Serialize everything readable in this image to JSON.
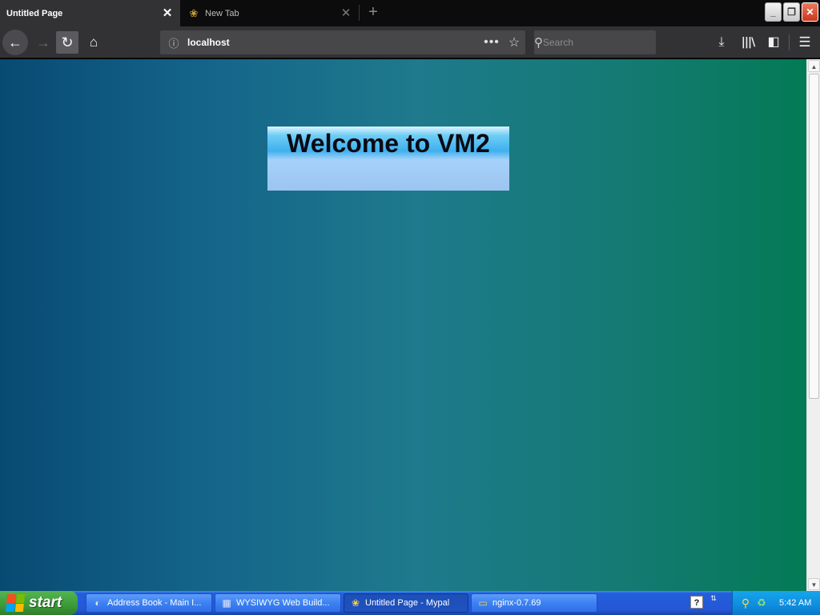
{
  "browser": {
    "tabs": [
      {
        "label": "Untitled Page",
        "active": true
      },
      {
        "label": "New Tab",
        "active": false
      }
    ],
    "url": "localhost",
    "search_placeholder": "Search",
    "icons": {
      "back": "arrow-left",
      "forward": "arrow-right",
      "reload": "reload",
      "home": "home",
      "info": "info-circle",
      "page_actions": "dots-menu",
      "bookmark": "star",
      "search": "magnifier",
      "download": "download-arrow",
      "library": "library",
      "sidebar": "sidebar",
      "menu": "hamburger"
    }
  },
  "page": {
    "banner_heading": "Welcome to VM2"
  },
  "taskbar": {
    "start_label": "start",
    "tasks": [
      {
        "label": "Address Book - Main I...",
        "icon": "book"
      },
      {
        "label": "WYSIWYG Web Build...",
        "icon": "wysiwyg-app"
      },
      {
        "label": "Untitled Page - Mypal",
        "icon": "mypal-browser",
        "active": true
      },
      {
        "label": "nginx-0.7.69",
        "icon": "folder"
      }
    ],
    "clock": "5:42 AM"
  },
  "colors": {
    "chrome_dark": "#0c0c0d",
    "chrome_bar": "#323234",
    "taskbar_blue": "#245edb",
    "start_green": "#3c9a38",
    "tray_blue": "#0f8de0"
  }
}
